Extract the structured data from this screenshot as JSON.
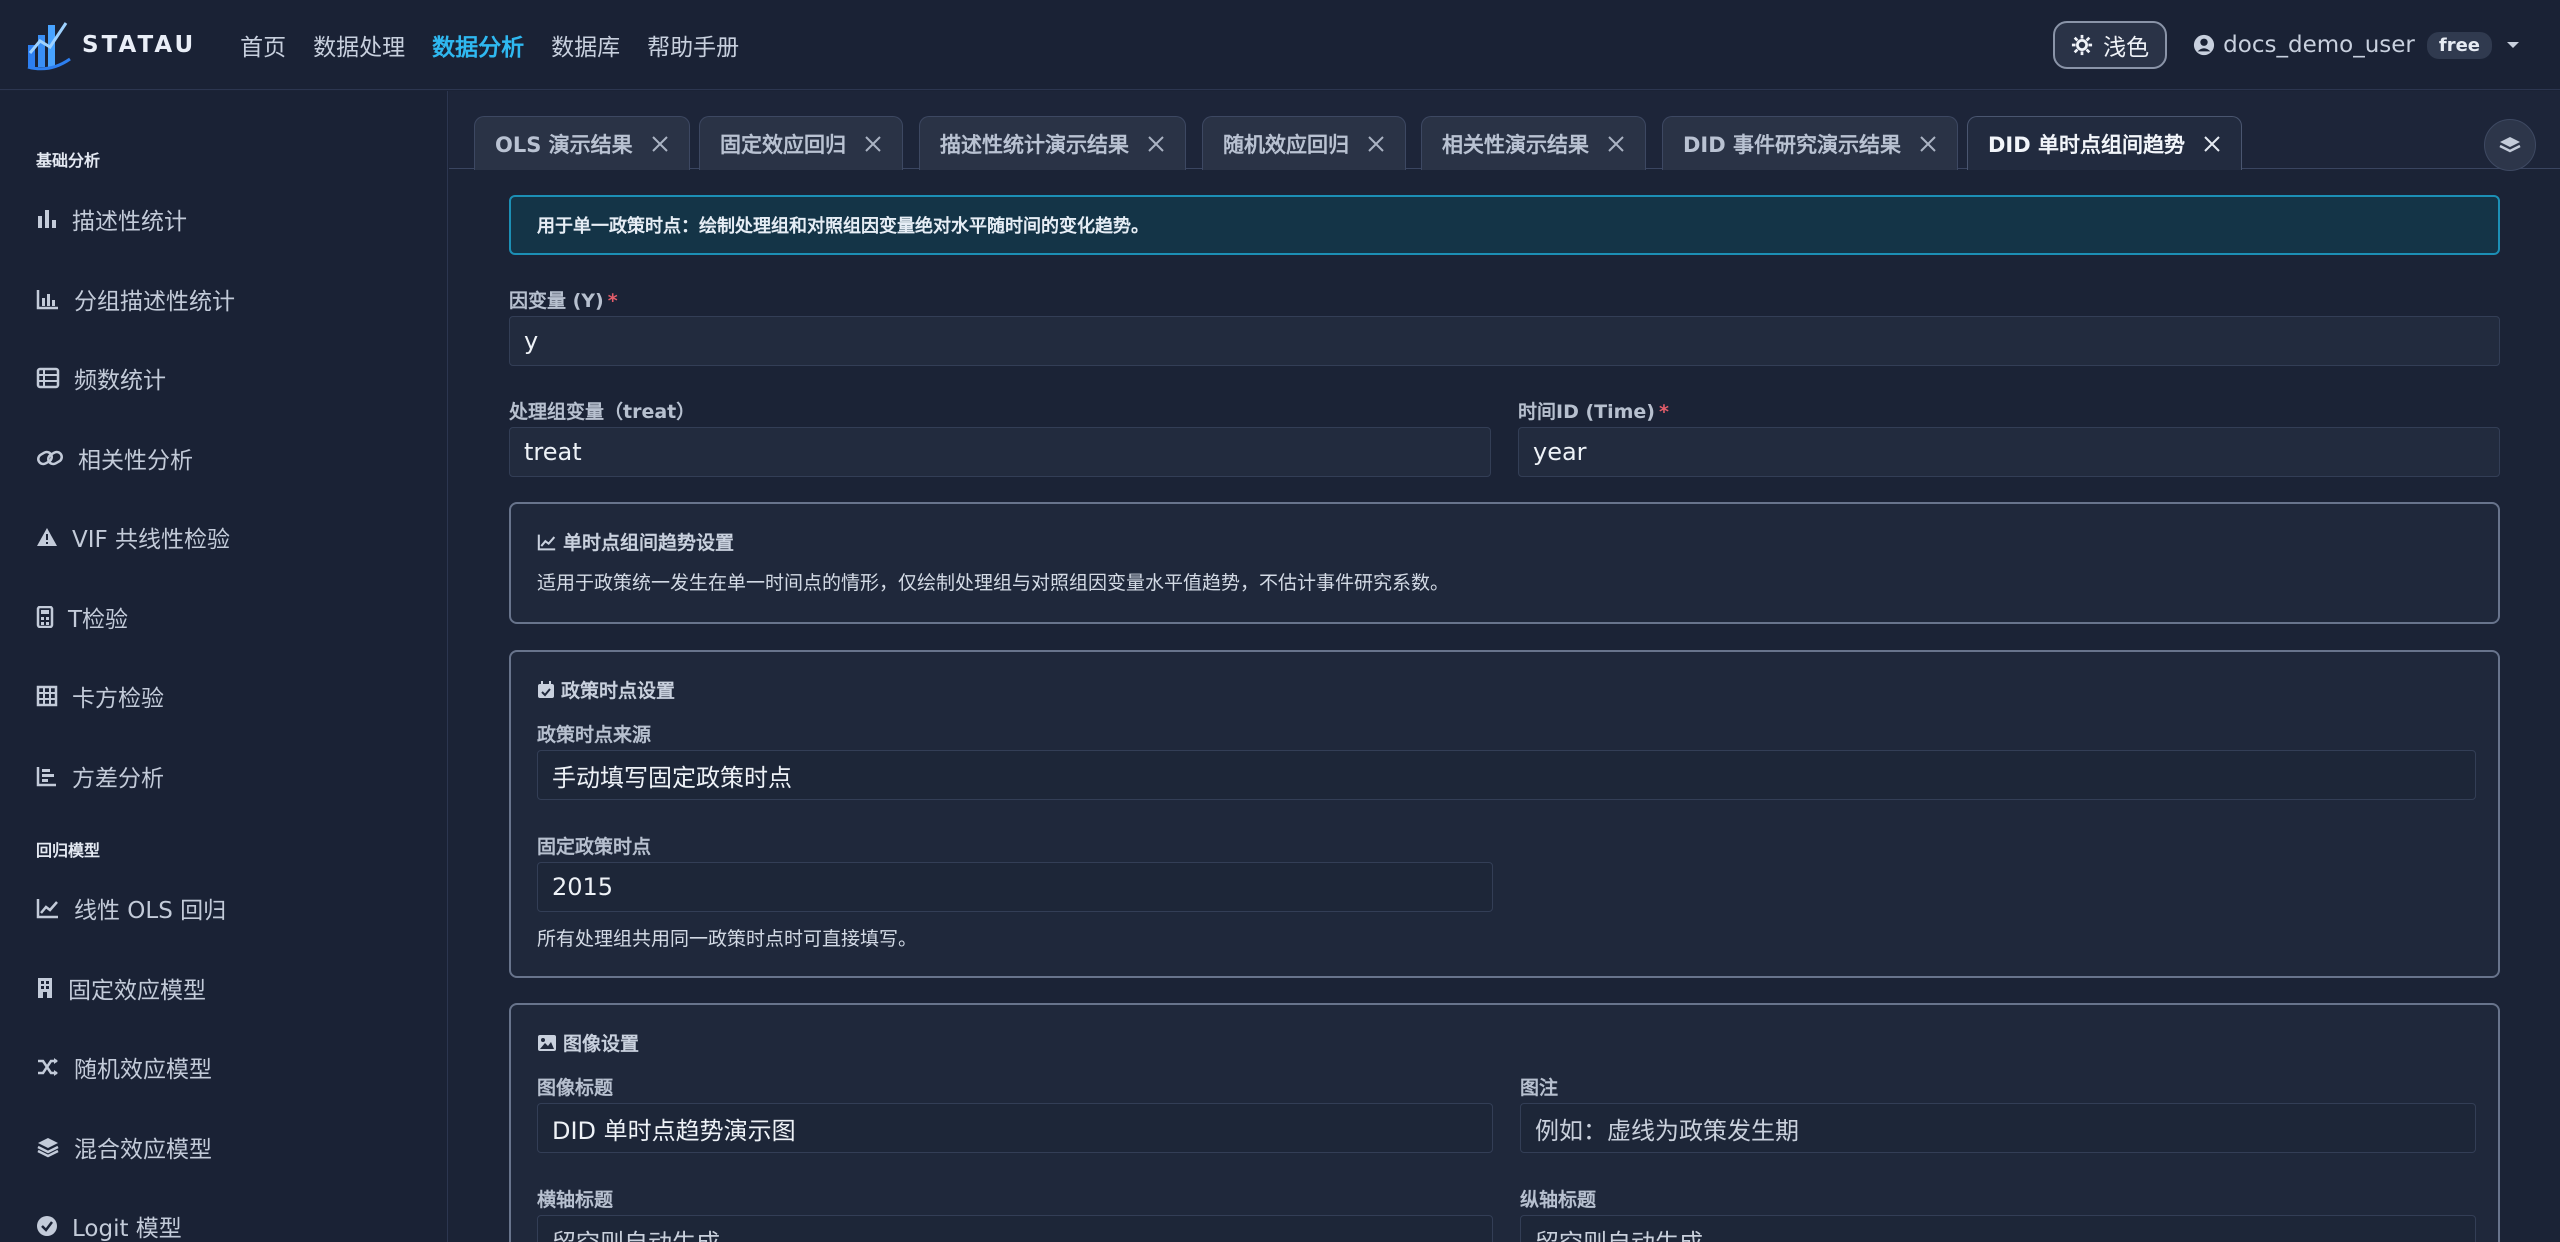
{
  "brand": {
    "name": "STATAU"
  },
  "nav": {
    "links": [
      "首页",
      "数据处理",
      "数据分析",
      "数据库",
      "帮助手册"
    ],
    "active_index": 2
  },
  "user": {
    "theme_label": "浅色",
    "name": "docs_demo_user",
    "plan": "free"
  },
  "sidebar": {
    "sections": [
      {
        "title": "基础分析",
        "items": [
          {
            "label": "描述性统计",
            "icon": "bar-chart-icon"
          },
          {
            "label": "分组描述性统计",
            "icon": "grouped-chart-icon"
          },
          {
            "label": "频数统计",
            "icon": "table-list-icon"
          },
          {
            "label": "相关性分析",
            "icon": "link-icon"
          },
          {
            "label": "VIF 共线性检验",
            "icon": "warning-icon"
          },
          {
            "label": "T检验",
            "icon": "calculator-icon"
          },
          {
            "label": "卡方检验",
            "icon": "grid-icon"
          },
          {
            "label": "方差分析",
            "icon": "bar-steps-icon"
          }
        ]
      },
      {
        "title": "回归模型",
        "items": [
          {
            "label": "线性 OLS 回归",
            "icon": "line-chart-icon"
          },
          {
            "label": "固定效应模型",
            "icon": "building-icon"
          },
          {
            "label": "随机效应模型",
            "icon": "shuffle-icon"
          },
          {
            "label": "混合效应模型",
            "icon": "layers-icon"
          },
          {
            "label": "Logit 模型",
            "icon": "check-circle-icon"
          }
        ]
      }
    ]
  },
  "tabs": [
    {
      "label": "OLS 演示结果"
    },
    {
      "label": "固定效应回归"
    },
    {
      "label": "描述性统计演示结果"
    },
    {
      "label": "随机效应回归"
    },
    {
      "label": "相关性演示结果"
    },
    {
      "label": "DID 事件研究演示结果"
    },
    {
      "label": "DID 单时点组间趋势",
      "active": true
    }
  ],
  "form": {
    "info": "用于单一政策时点：绘制处理组和对照组因变量绝对水平随时间的变化趋势。",
    "dep_var": {
      "label": "因变量 (Y)",
      "value": "y",
      "required": "*"
    },
    "treat_var": {
      "label": "处理组变量（treat）",
      "value": "treat"
    },
    "time_var": {
      "label": "时间ID (Time)",
      "value": "year",
      "required": "*"
    },
    "trend_card": {
      "title": "单时点组间趋势设置",
      "text": "适用于政策统一发生在单一时间点的情形，仅绘制处理组与对照组因变量水平值趋势，不估计事件研究系数。"
    },
    "policy_card": {
      "title": "政策时点设置",
      "source_label": "政策时点来源",
      "source_value": "手动填写固定政策时点",
      "fixed_label": "固定政策时点",
      "fixed_value": "2015",
      "hint": "所有处理组共用同一政策时点时可直接填写。"
    },
    "image_card": {
      "title": "图像设置",
      "title_label": "图像标题",
      "title_value": "DID 单时点趋势演示图",
      "note_label": "图注",
      "note_placeholder": "例如：虚线为政策发生期",
      "xlabel_label": "横轴标题",
      "xlabel_placeholder": "留空则自动生成",
      "ylabel_label": "纵轴标题",
      "ylabel_placeholder": "留空则自动生成"
    }
  },
  "colors": {
    "accent": "#2fb8f0",
    "required": "#e35d6a",
    "info_border": "#1c8fb5"
  }
}
